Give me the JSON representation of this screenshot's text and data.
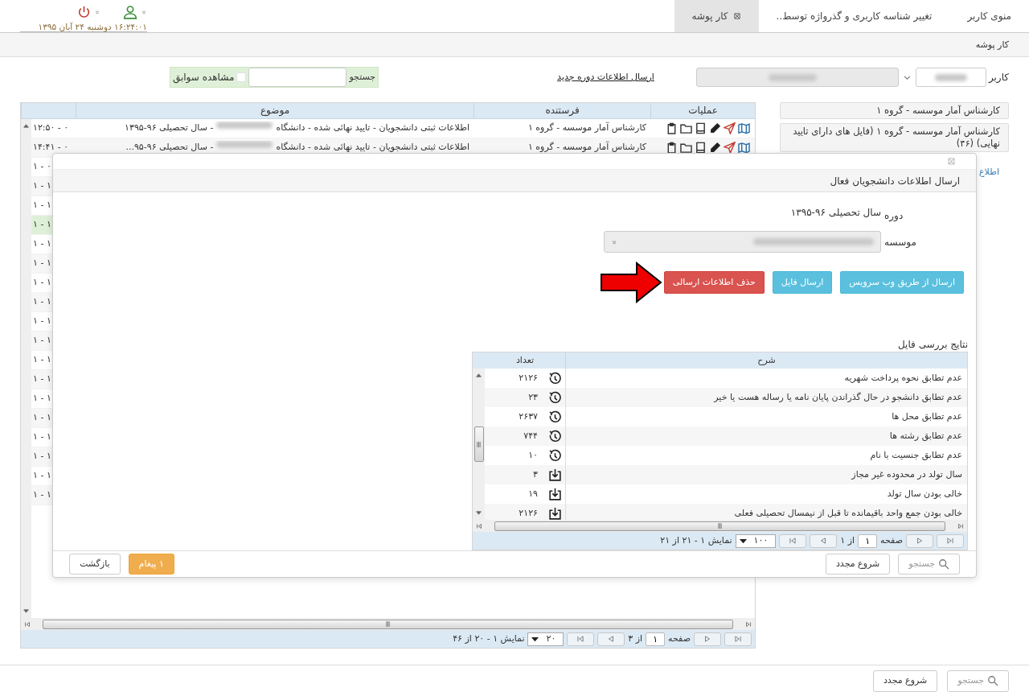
{
  "header": {
    "datetime": "۱۶:۲۴:۰۱ دوشنبه ۲۴ آبان ۱۳۹۵"
  },
  "tabs": [
    {
      "label": "منوی کاربر",
      "selected": false,
      "closable": false
    },
    {
      "label": "تغییر شناسه کاربری و گذرواژه توسط..",
      "selected": false,
      "closable": false
    },
    {
      "label": "کار پوشه",
      "selected": true,
      "closable": true
    }
  ],
  "breadcrumb": "کار پوشه",
  "filter": {
    "user_label": "کاربر",
    "new_period_link": "ارسال اطلاعات دوره جدید",
    "search_label": "جستجو",
    "history": {
      "label": "مشاهده سوابق",
      "checked": false
    }
  },
  "folders": [
    {
      "label": "کارشناس آمار موسسه - گروه ۱",
      "selected": false
    },
    {
      "label": "کارشناس آمار موسسه - گروه ۱ (فایل های دارای تایید نهایی) (۴۶)",
      "selected": false
    },
    {
      "label": "اطلاع",
      "kind": "link"
    }
  ],
  "grid": {
    "columns": [
      "عملیات",
      "فرستنده",
      "موضوع"
    ],
    "rows": [
      {
        "sender": "کارشناس آمار موسسه - گروه ۱",
        "subject_start": "اطلاعات ثبتی دانشجویان - تایید نهائی شده - دانشگاه",
        "subject_end": "- سال تحصیلی ۹۶-۱۳۹۵",
        "time": "۰ - ۱۲:۵۰",
        "selected": false
      },
      {
        "sender": "کارشناس آمار موسسه - گروه ۱",
        "subject_start": "اطلاعات ثبتی دانشجویان - تایید نهائی شده - دانشگاه",
        "subject_end": "- سال تحصیلی ۹۶-۹۵...",
        "time": "۰ - ۱۴:۴۱",
        "selected": false
      },
      {
        "time": "۰ - ۱",
        "selected": false
      },
      {
        "time": "۱ - ۱",
        "selected": false
      },
      {
        "time": "۱ - ۱",
        "selected": false
      },
      {
        "time": "۱ - ۱",
        "selected": true
      },
      {
        "time": "۱ - ۱",
        "selected": false
      },
      {
        "time": "۱ - ۱",
        "selected": false
      },
      {
        "time": "۱ - ۱",
        "selected": false
      },
      {
        "time": "۱ - ۱",
        "selected": false
      },
      {
        "time": "۱ - ۱",
        "selected": false
      },
      {
        "time": "۱ - ۱",
        "selected": false
      },
      {
        "time": "۱ - ۱",
        "selected": false
      },
      {
        "time": "۱ - ۱",
        "selected": false
      },
      {
        "time": "۱ - ۱",
        "selected": false
      },
      {
        "time": "۱ - ۱",
        "selected": false
      },
      {
        "time": "۱ - ۱",
        "selected": false
      },
      {
        "time": "۱ - ۱",
        "selected": false
      },
      {
        "time": "۱ - ۱",
        "selected": false
      },
      {
        "time": "۱ - ۱",
        "selected": false
      }
    ],
    "pager": {
      "page_label": "صفحه",
      "page": "۱",
      "of": "از ۳",
      "page_size": "۲۰",
      "summary": "نمایش ۱ - ۲۰ از ۴۶"
    }
  },
  "modal": {
    "title": "ارسال اطلاعات دانشجویان فعال",
    "fields": [
      {
        "label": "دوره",
        "kind": "text",
        "value": "سال تحصیلی ۹۶-۱۳۹۵"
      },
      {
        "label": "موسسه",
        "kind": "select"
      }
    ],
    "buttons": [
      {
        "label": "ارسال از طریق وب سرویس",
        "kind": "info"
      },
      {
        "label": "ارسال فایل",
        "kind": "info"
      },
      {
        "label": "حذف اطلاعات ارسالی",
        "kind": "danger"
      }
    ],
    "results": {
      "title": "نتایج بررسی فایل",
      "columns": [
        "شرح",
        "تعداد"
      ],
      "rows": [
        {
          "description": "عدم تطابق نحوه پرداخت شهریه",
          "count": "۲۱۲۶",
          "kind": "clock"
        },
        {
          "description": "عدم تطابق دانشجو در حال گذراندن پایان نامه یا رساله هست یا خیر",
          "count": "۲۳",
          "kind": "clock"
        },
        {
          "description": "عدم تطابق محل ها",
          "count": "۲۶۳۷",
          "kind": "clock"
        },
        {
          "description": "عدم تطابق رشته ها",
          "count": "۷۴۴",
          "kind": "clock"
        },
        {
          "description": "عدم تطابق جنسیت با نام",
          "count": "۱۰",
          "kind": "clock"
        },
        {
          "description": "سال تولد در محدوده غیر مجاز",
          "count": "۳",
          "kind": "download"
        },
        {
          "description": "خالی بودن سال تولد",
          "count": "۱۹",
          "kind": "download"
        },
        {
          "description": "خالی بودن جمع واحد باقیمانده تا قبل از نیمسال تحصیلی فعلی",
          "count": "۲۱۲۶",
          "kind": "download"
        }
      ],
      "pager": {
        "page_label": "صفحه",
        "page": "۱",
        "of": "از ۱",
        "page_size": "۱۰۰",
        "summary": "نمایش ۱ - ۲۱ از ۲۱"
      }
    },
    "footer": {
      "search": {
        "label": "جستجو",
        "disabled": true
      },
      "reset": "شروع مجدد",
      "messages": "۱ پیغام",
      "back": "بازگشت"
    }
  },
  "footer": {
    "search": {
      "label": "جستجو",
      "disabled": true
    },
    "reset": "شروع مجدد"
  }
}
